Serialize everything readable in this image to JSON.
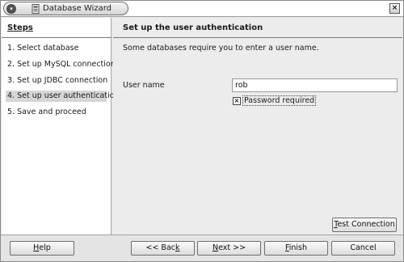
{
  "window": {
    "title": "Database Wizard",
    "menu_glyph": "▾",
    "close_glyph": "×"
  },
  "steps": {
    "title": "Steps",
    "items": [
      {
        "label": "1. Select database",
        "active": false
      },
      {
        "label": "2. Set up MySQL connection",
        "active": false
      },
      {
        "label": "3. Set up JDBC connection",
        "active": false
      },
      {
        "label": "4. Set up user authentication",
        "active": true
      },
      {
        "label": "5. Save and proceed",
        "active": false
      }
    ]
  },
  "content": {
    "title": "Set up the user authentication",
    "description": "Some databases require you to enter a user name.",
    "user_name_label": "User name",
    "user_name_value": "rob",
    "password_checkbox_mark": "×",
    "password_checkbox_label": "Password required",
    "password_checked": true,
    "test_connection": {
      "mnemonic": "T",
      "rest": "est Connection"
    }
  },
  "footer": {
    "help": {
      "mnemonic": "H",
      "rest": "elp"
    },
    "back": {
      "prefix": "<< Bac",
      "mnemonic": "k",
      "rest": ""
    },
    "next": {
      "prefix": "",
      "mnemonic": "N",
      "rest": "ext >>"
    },
    "finish": {
      "mnemonic": "F",
      "rest": "inish"
    },
    "cancel": {
      "label": "Cancel"
    }
  },
  "icons": {
    "menu": "window-menu-icon",
    "app": "database-wizard-app-icon",
    "close": "close-icon",
    "checkbox": "checkbox-checked-icon"
  }
}
